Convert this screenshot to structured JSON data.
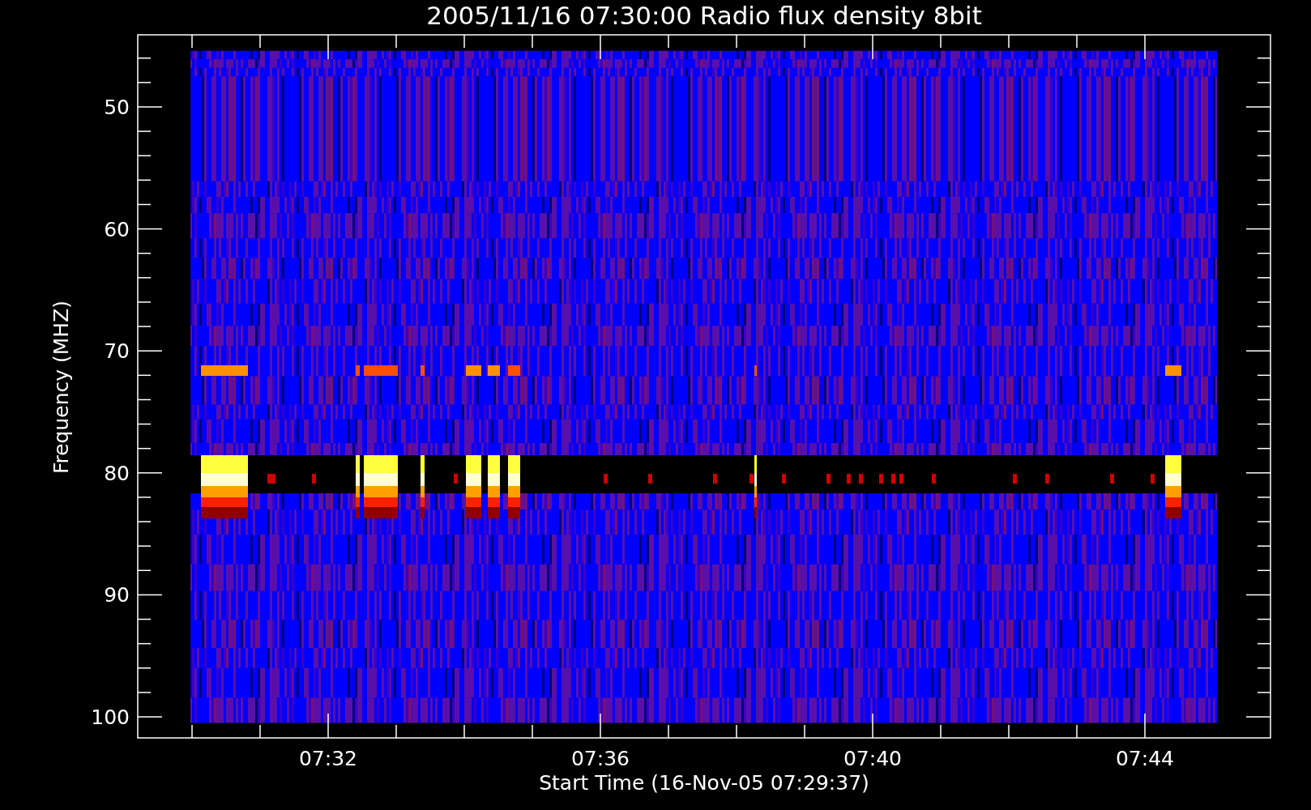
{
  "title": "2005/11/16 07:30:00 Radio flux density 8bit",
  "y_axis": {
    "label": "Frequency (MHZ)",
    "ticks": [
      "50",
      "60",
      "70",
      "80",
      "90",
      "100"
    ]
  },
  "x_axis": {
    "label": "Start Time (16-Nov-05 07:29:37)",
    "ticks": [
      "07:32",
      "07:36",
      "07:40",
      "07:44"
    ]
  }
}
